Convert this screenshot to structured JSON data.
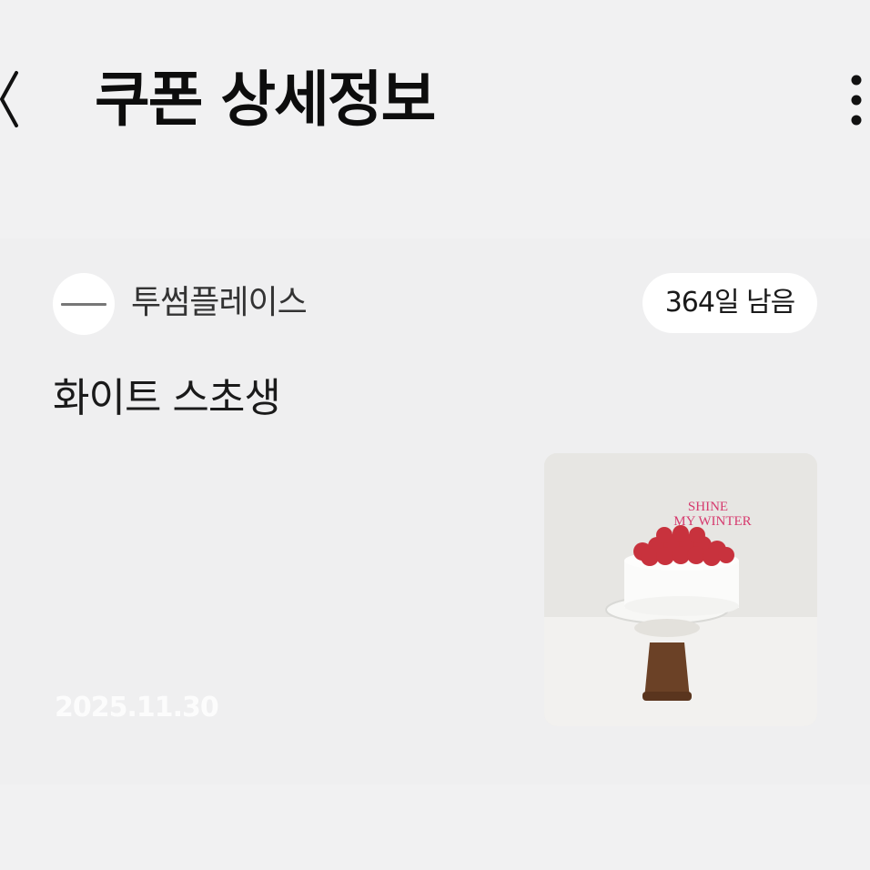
{
  "header": {
    "title": "쿠폰 상세정보",
    "back_icon": "chevron-left-icon",
    "more_icon": "more-vertical-icon"
  },
  "coupon": {
    "store_name": "투썸플레이스",
    "days_left": "364일 남음",
    "product_name": "화이트 스초생",
    "expiry_date": "2025.11.30",
    "image_text_line1": "SHINE",
    "image_text_line2": "MY WINTER"
  },
  "colors": {
    "background": "#f1f1f2",
    "badge_background": "#ffffff",
    "topper_pink": "#d63a6e",
    "berry_red": "#c8323d",
    "stand_wood": "#6b4126"
  }
}
